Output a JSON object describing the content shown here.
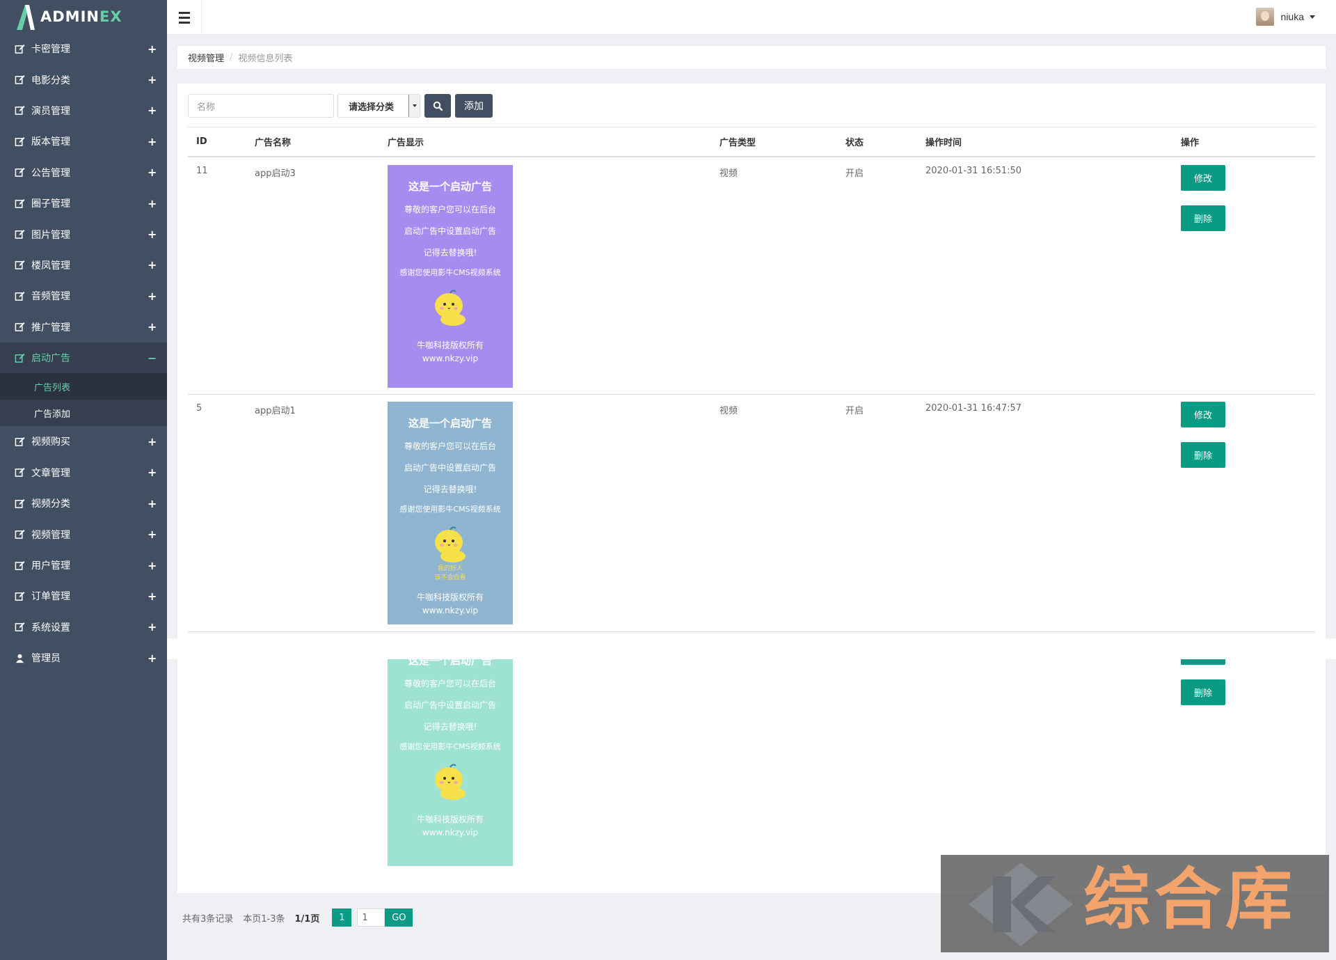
{
  "brand": {
    "name_main": "ADMIN",
    "name_accent": "EX"
  },
  "header": {
    "user_name": "niuka"
  },
  "sidebar": {
    "items": [
      {
        "label": "卡密管理",
        "expander": "+"
      },
      {
        "label": "电影分类",
        "expander": "+"
      },
      {
        "label": "演员管理",
        "expander": "+"
      },
      {
        "label": "版本管理",
        "expander": "+"
      },
      {
        "label": "公告管理",
        "expander": "+"
      },
      {
        "label": "圈子管理",
        "expander": "+"
      },
      {
        "label": "图片管理",
        "expander": "+"
      },
      {
        "label": "楼凤管理",
        "expander": "+"
      },
      {
        "label": "音频管理",
        "expander": "+"
      },
      {
        "label": "推广管理",
        "expander": "+"
      },
      {
        "label": "启动广告",
        "expander": "−"
      },
      {
        "label": "视频购买",
        "expander": "+"
      },
      {
        "label": "文章管理",
        "expander": "+"
      },
      {
        "label": "视频分类",
        "expander": "+"
      },
      {
        "label": "视频管理",
        "expander": "+"
      },
      {
        "label": "用户管理",
        "expander": "+"
      },
      {
        "label": "订单管理",
        "expander": "+"
      },
      {
        "label": "系统设置",
        "expander": "+"
      },
      {
        "label": "管理员",
        "expander": "+"
      }
    ],
    "sub_items": [
      {
        "label": "广告列表"
      },
      {
        "label": "广告添加"
      }
    ]
  },
  "breadcrumb": {
    "first": "视频管理",
    "sep": "/",
    "current": "视频信息列表"
  },
  "toolbar": {
    "name_placeholder": "名称",
    "category_select": "请选择分类",
    "add_label": "添加"
  },
  "table": {
    "headers": [
      "ID",
      "广告名称",
      "广告显示",
      "广告类型",
      "状态",
      "操作时间",
      "操作"
    ],
    "rows": [
      {
        "id": "11",
        "name": "app启动3",
        "type": "视频",
        "status": "开启",
        "time": "2020-01-31 16:51:50",
        "edit": "修改",
        "delete": "删除"
      },
      {
        "id": "5",
        "name": "app启动1",
        "type": "视频",
        "status": "开启",
        "time": "2020-01-31 16:47:57",
        "edit": "修改",
        "delete": "删除"
      },
      {
        "id": "",
        "name": "",
        "type": "",
        "status": "",
        "time": "",
        "edit": "",
        "delete": "删除"
      }
    ]
  },
  "ads": [
    {
      "title": "这是一个启动广告",
      "line1": "尊敬的客户您可以在后台",
      "line2": "启动广告中设置启动广告",
      "line3": "记得去替换哦!",
      "line4": "感谢您使用影牛CMS视频系统",
      "footer1": "牛咖科技版权所有",
      "footer2": "www.nkzy.vip",
      "bg": "#a78cf0"
    },
    {
      "title": "这是一个启动广告",
      "line1": "尊敬的客户您可以在后台",
      "line2": "启动广告中设置启动广告",
      "line3": "记得去替换哦!",
      "line4": "感谢您使用影牛CMS视频系统",
      "extra1": "我的好人",
      "extra2": "该不会白看",
      "footer1": "牛咖科技版权所有",
      "footer2": "www.nkzy.vip",
      "bg": "#8fb5d0"
    },
    {
      "title": "这是一个启动广告",
      "line1": "尊敬的客户您可以在后台",
      "line2": "启动广告中设置启动广告",
      "line3": "记得去替换哦!",
      "line4": "感谢您使用影牛CMS视频系统",
      "footer1": "牛咖科技版权所有",
      "footer2": "www.nkzy.vip",
      "bg": "#9ee3d2"
    }
  ],
  "pager": {
    "total": "共有3条记录",
    "range": "本页1-3条",
    "pages": "1/1页",
    "current": "1",
    "input": "1",
    "go": "GO"
  },
  "watermark": {
    "text": "综合库"
  },
  "colors": {
    "sidebar": "#424f63",
    "accent": "#65cea7",
    "button_green": "#0a9b84"
  }
}
